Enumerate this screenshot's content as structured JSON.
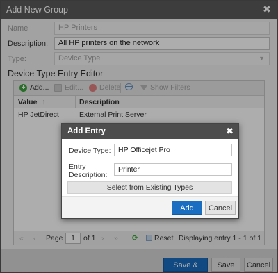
{
  "window": {
    "title": "Add New Group"
  },
  "form": {
    "name_label": "Name",
    "name_value": "HP Printers",
    "description_label": "Description:",
    "description_value": "All HP printers on the network",
    "type_label": "Type:",
    "type_value": "Device Type"
  },
  "editor": {
    "title": "Device Type Entry Editor",
    "toolbar": {
      "add": "Add...",
      "edit": "Edit...",
      "delete": "Delete",
      "show_filters": "Show Filters"
    },
    "columns": [
      "Value",
      "Description"
    ],
    "rows": [
      {
        "value": "HP JetDirect",
        "description": "External Print Server"
      }
    ],
    "pager": {
      "page_label": "Page",
      "page_value": "1",
      "of_label": "of 1",
      "reset": "Reset",
      "status": "Displaying entry 1 - 1 of 1"
    }
  },
  "footer": {
    "save_close": "Save & Close",
    "save": "Save",
    "cancel": "Cancel"
  },
  "modal": {
    "title": "Add Entry",
    "device_type_label": "Device Type:",
    "device_type_value": "HP Officejet Pro",
    "entry_desc_label_1": "Entry",
    "entry_desc_label_2": "Description:",
    "entry_desc_value": "Printer",
    "select_existing": "Select from Existing Types",
    "add": "Add",
    "cancel": "Cancel"
  },
  "colors": {
    "primary_button": "#1a6ec2",
    "title_bar": "#5b5b5b",
    "add_icon": "#3ba33b",
    "delete_icon": "#e27f7f"
  },
  "icons": {
    "close": "close-icon",
    "add": "plus-circle-icon",
    "edit": "edit-icon",
    "delete": "minus-circle-icon",
    "columns": "grid-icon",
    "filter": "filter-icon",
    "refresh": "refresh-icon",
    "sort": "sort-up-icon"
  }
}
